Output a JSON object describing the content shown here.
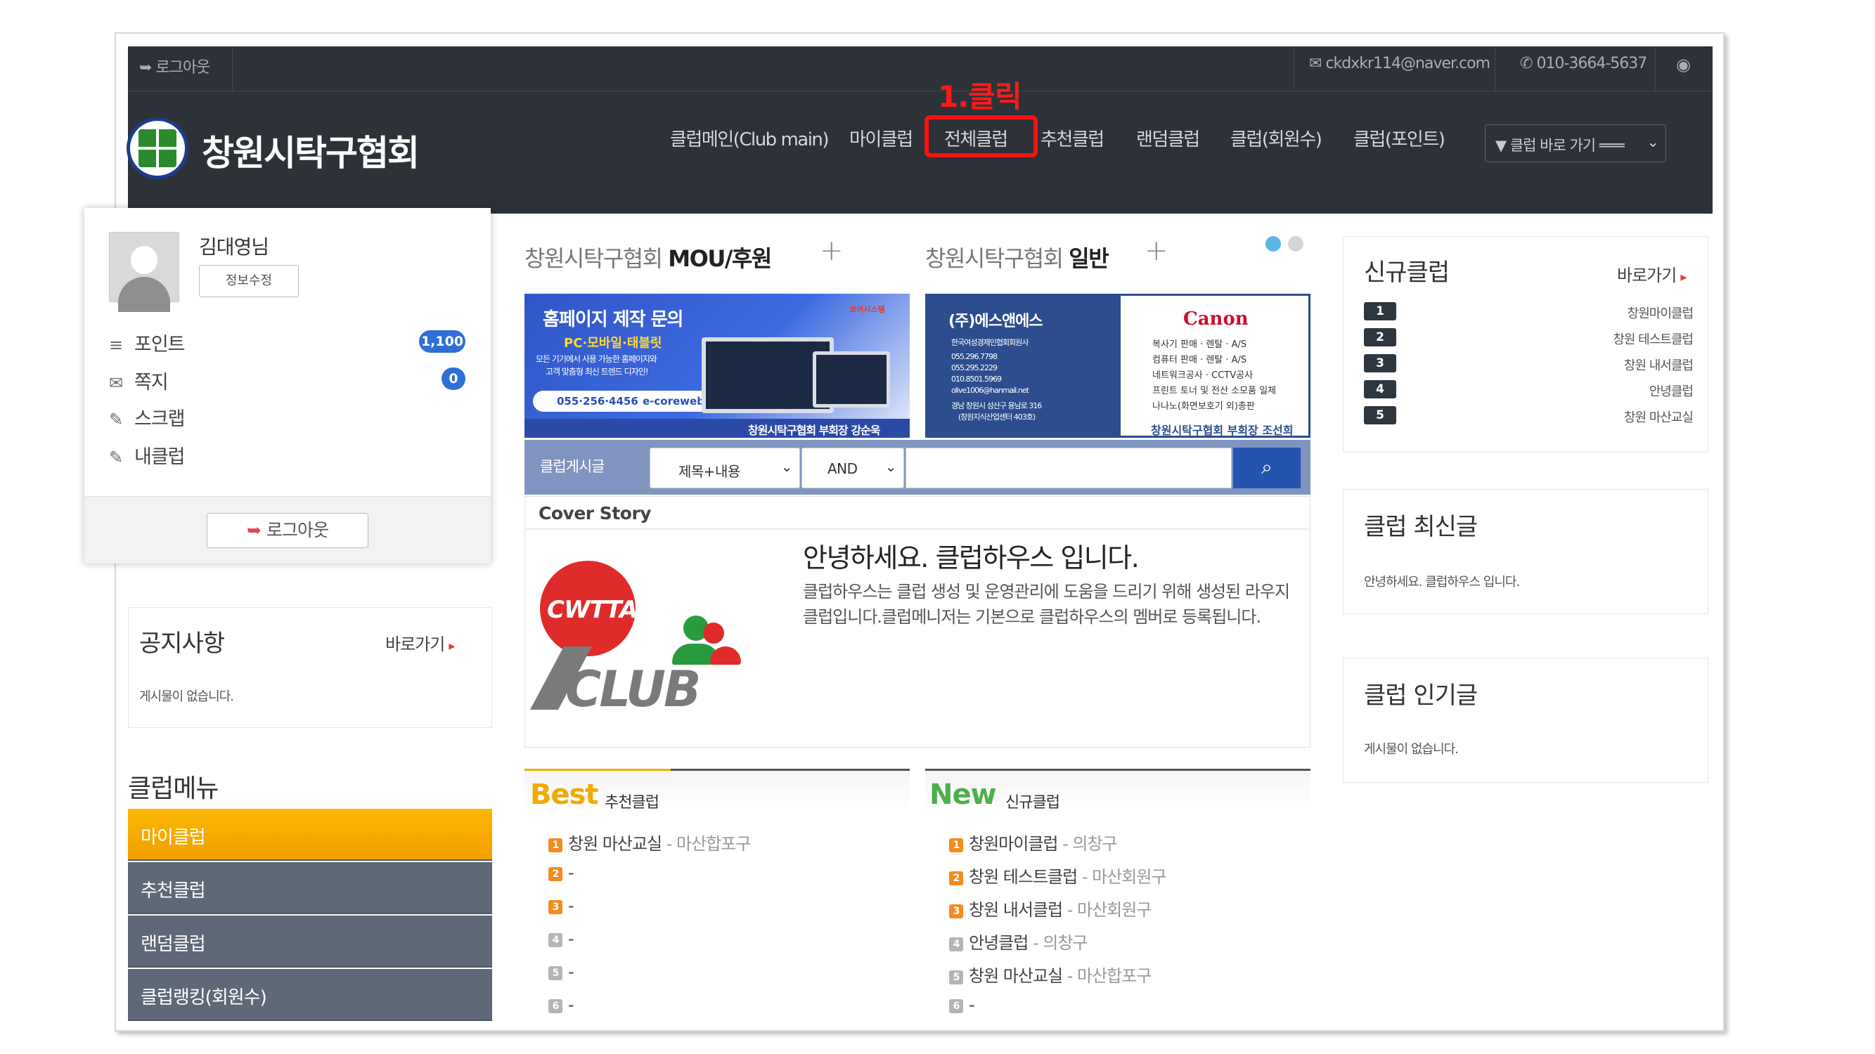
{
  "topbar": {
    "logout": "로그아웃",
    "email": "ckdxkr114@naver.com",
    "phone": "010-3664-5637"
  },
  "header": {
    "site_title": "창원시탁구협회",
    "annotation": "1.클릭",
    "quick_select": "▼ 클럽 바로 가기 ═══",
    "nav": [
      "클럽메인(Club main)",
      "마이클럽",
      "전체클럽",
      "추천클럽",
      "랜덤클럽",
      "클럽(회원수)",
      "클럽(포인트)"
    ]
  },
  "login": {
    "user_name": "김대영님",
    "edit_button": "정보수정",
    "items": [
      {
        "label": "포인트",
        "badge": "1,100"
      },
      {
        "label": "쪽지",
        "badge": "0"
      },
      {
        "label": "스크랩"
      },
      {
        "label": "내클럽"
      }
    ],
    "logout_button": "로그아웃"
  },
  "notice": {
    "title": "공지사항",
    "more": "바로가기",
    "empty": "게시물이 없습니다."
  },
  "club_menu": {
    "title": "클럽메뉴",
    "items": [
      "마이클럽",
      "추천클럽",
      "랜덤클럽",
      "클럽랭킹(회원수)"
    ]
  },
  "sections": {
    "left_prefix": "창원시탁구협회",
    "left_bold": "MOU/후원",
    "right_prefix": "창원시탁구협회",
    "right_bold": "일반"
  },
  "banner1": {
    "title": "홈페이지 제작 문의",
    "sub": "PC·모바일·태블릿",
    "line1": "모든 기기에서 사용 가능한 홈페이지와",
    "line2": "고객 맞춤형 최신 트렌드 디자인!",
    "phone": "055·256·4456",
    "site": "e-coreweb.co.kr",
    "footer": "창원시탁구협회 부회장 강순욱",
    "brand": "코어시스템"
  },
  "banner2": {
    "title": "(주)에스앤에스",
    "brand": "Canon",
    "left_lines": [
      "한국여성경제인협회회원사",
      "055.296.7798",
      "055.295.2229",
      "010.8501.5969",
      "olive1006@hanmail.net",
      "경남 창원시 성산구 용남로 316",
      "(창원지식산업센터 403호)"
    ],
    "right_lines": [
      "복사기 판매 · 렌탈 · A/S",
      "컴퓨터 판매 · 렌탈 · A/S",
      "네트워크공사 · CCTV공사",
      "프린트 토너 및 전산 소모품 일체",
      "나나노(화면보호기 외)총판"
    ],
    "footer": "창원시탁구협회 부회장 조선희"
  },
  "search": {
    "label": "클럽게시글",
    "field_select": "제목+내용",
    "op_select": "AND"
  },
  "cover": {
    "label": "Cover Story",
    "heading": "안녕하세요. 클럽하우스 입니다.",
    "line1": "클럽하우스는 클럽 생성 및 운영관리에 도움을 드리기 위해 생성된 라우지",
    "line2": "클럽입니다.클럽메니저는 기본으로 클럽하우스의 멤버로 등록됩니다.",
    "logo_top": "CWTTA",
    "logo_bottom": "CLUB"
  },
  "best": {
    "big": "Best",
    "small": "추천클럽",
    "items": [
      {
        "num": "1",
        "name": "창원 마산교실",
        "sub": " - 마산합포구"
      },
      {
        "num": "2",
        "name": "-",
        "sub": ""
      },
      {
        "num": "3",
        "name": "-",
        "sub": ""
      },
      {
        "num": "4",
        "name": "-",
        "sub": ""
      },
      {
        "num": "5",
        "name": "-",
        "sub": ""
      },
      {
        "num": "6",
        "name": "-",
        "sub": ""
      }
    ]
  },
  "new": {
    "big": "New",
    "small": "신규클럽",
    "items": [
      {
        "num": "1",
        "name": "창원마이클럽",
        "sub": " - 의창구"
      },
      {
        "num": "2",
        "name": "창원 테스트클럽",
        "sub": " - 마산회원구"
      },
      {
        "num": "3",
        "name": "창원 내서클럽",
        "sub": " - 마산회원구"
      },
      {
        "num": "4",
        "name": "안녕클럽",
        "sub": " - 의창구"
      },
      {
        "num": "5",
        "name": "창원 마산교실",
        "sub": " - 마산합포구"
      },
      {
        "num": "6",
        "name": "-",
        "sub": ""
      }
    ]
  },
  "new_clubs": {
    "title": "신규클럽",
    "more": "바로가기",
    "items": [
      {
        "num": "1",
        "name": "창원마이클럽"
      },
      {
        "num": "2",
        "name": "창원 테스트클럽"
      },
      {
        "num": "3",
        "name": "창원 내서클럽"
      },
      {
        "num": "4",
        "name": "안녕클럽"
      },
      {
        "num": "5",
        "name": "창원 마산교실"
      }
    ]
  },
  "latest": {
    "title": "클럽 최신글",
    "item": "안녕하세요. 클럽하우스 입니다."
  },
  "popular": {
    "title": "클럽 인기글",
    "empty": "게시물이 없습니다."
  }
}
